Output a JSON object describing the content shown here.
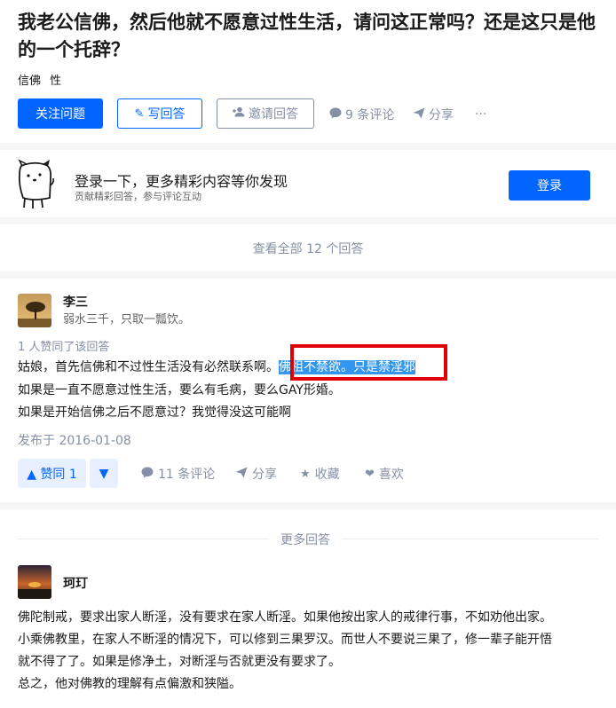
{
  "question": {
    "title": "我老公信佛，然后他就不愿意过性生活，请问这正常吗？还是这只是他的一个托辞？",
    "tags": [
      "信佛",
      "性"
    ],
    "follow_label": "关注问题",
    "write_label": "写回答",
    "invite_label": "邀请回答",
    "comments_label": "9 条评论",
    "share_label": "分享",
    "more_label": "···"
  },
  "login": {
    "title": "登录一下，更多精彩内容等你发现",
    "subtitle": "贡献精彩回答，参与评论互动",
    "button": "登录"
  },
  "view_all": "查看全部 12 个回答",
  "answer": {
    "author_name": "李三",
    "author_bio": "弱水三千，只取一瓢饮。",
    "upvote_note": "1 人赞同了该回答",
    "line1_plain": "姑娘，首先信佛和不过性生活没有必然联系啊。",
    "line1_highlight": "佛祖不禁欲。只是禁淫邪",
    "line2": "如果是一直不愿意过性生活，要么有毛病，要么GAY形婚。",
    "line3": "如果是开始信佛之后不愿意过？我觉得没这可能啊",
    "date": "发布于 2016-01-08",
    "vote_label": "▲ 赞同 1",
    "comments_label": "11 条评论",
    "share_label": "分享",
    "collect_label": "收藏",
    "like_label": "喜欢"
  },
  "more": {
    "label": "更多回答",
    "author_name": "珂玎",
    "lines": [
      "佛陀制戒，要求出家人断淫，没有要求在家人断淫。如果他按出家人的戒律行事，不如劝他出家。",
      "小乘佛教里，在家人不断淫的情况下，可以修到三果罗汉。而世人不要说三果了，修一辈子能开悟",
      "就不得了了。如果是修净土，对断淫与否就更没有要求了。",
      "总之，他对佛教的理解有点偏激和狭隘。"
    ]
  },
  "colors": {
    "accent": "#0066ff",
    "muted": "#8590a6",
    "highlight": "#3296f0",
    "annotation_box": "#e00000"
  }
}
